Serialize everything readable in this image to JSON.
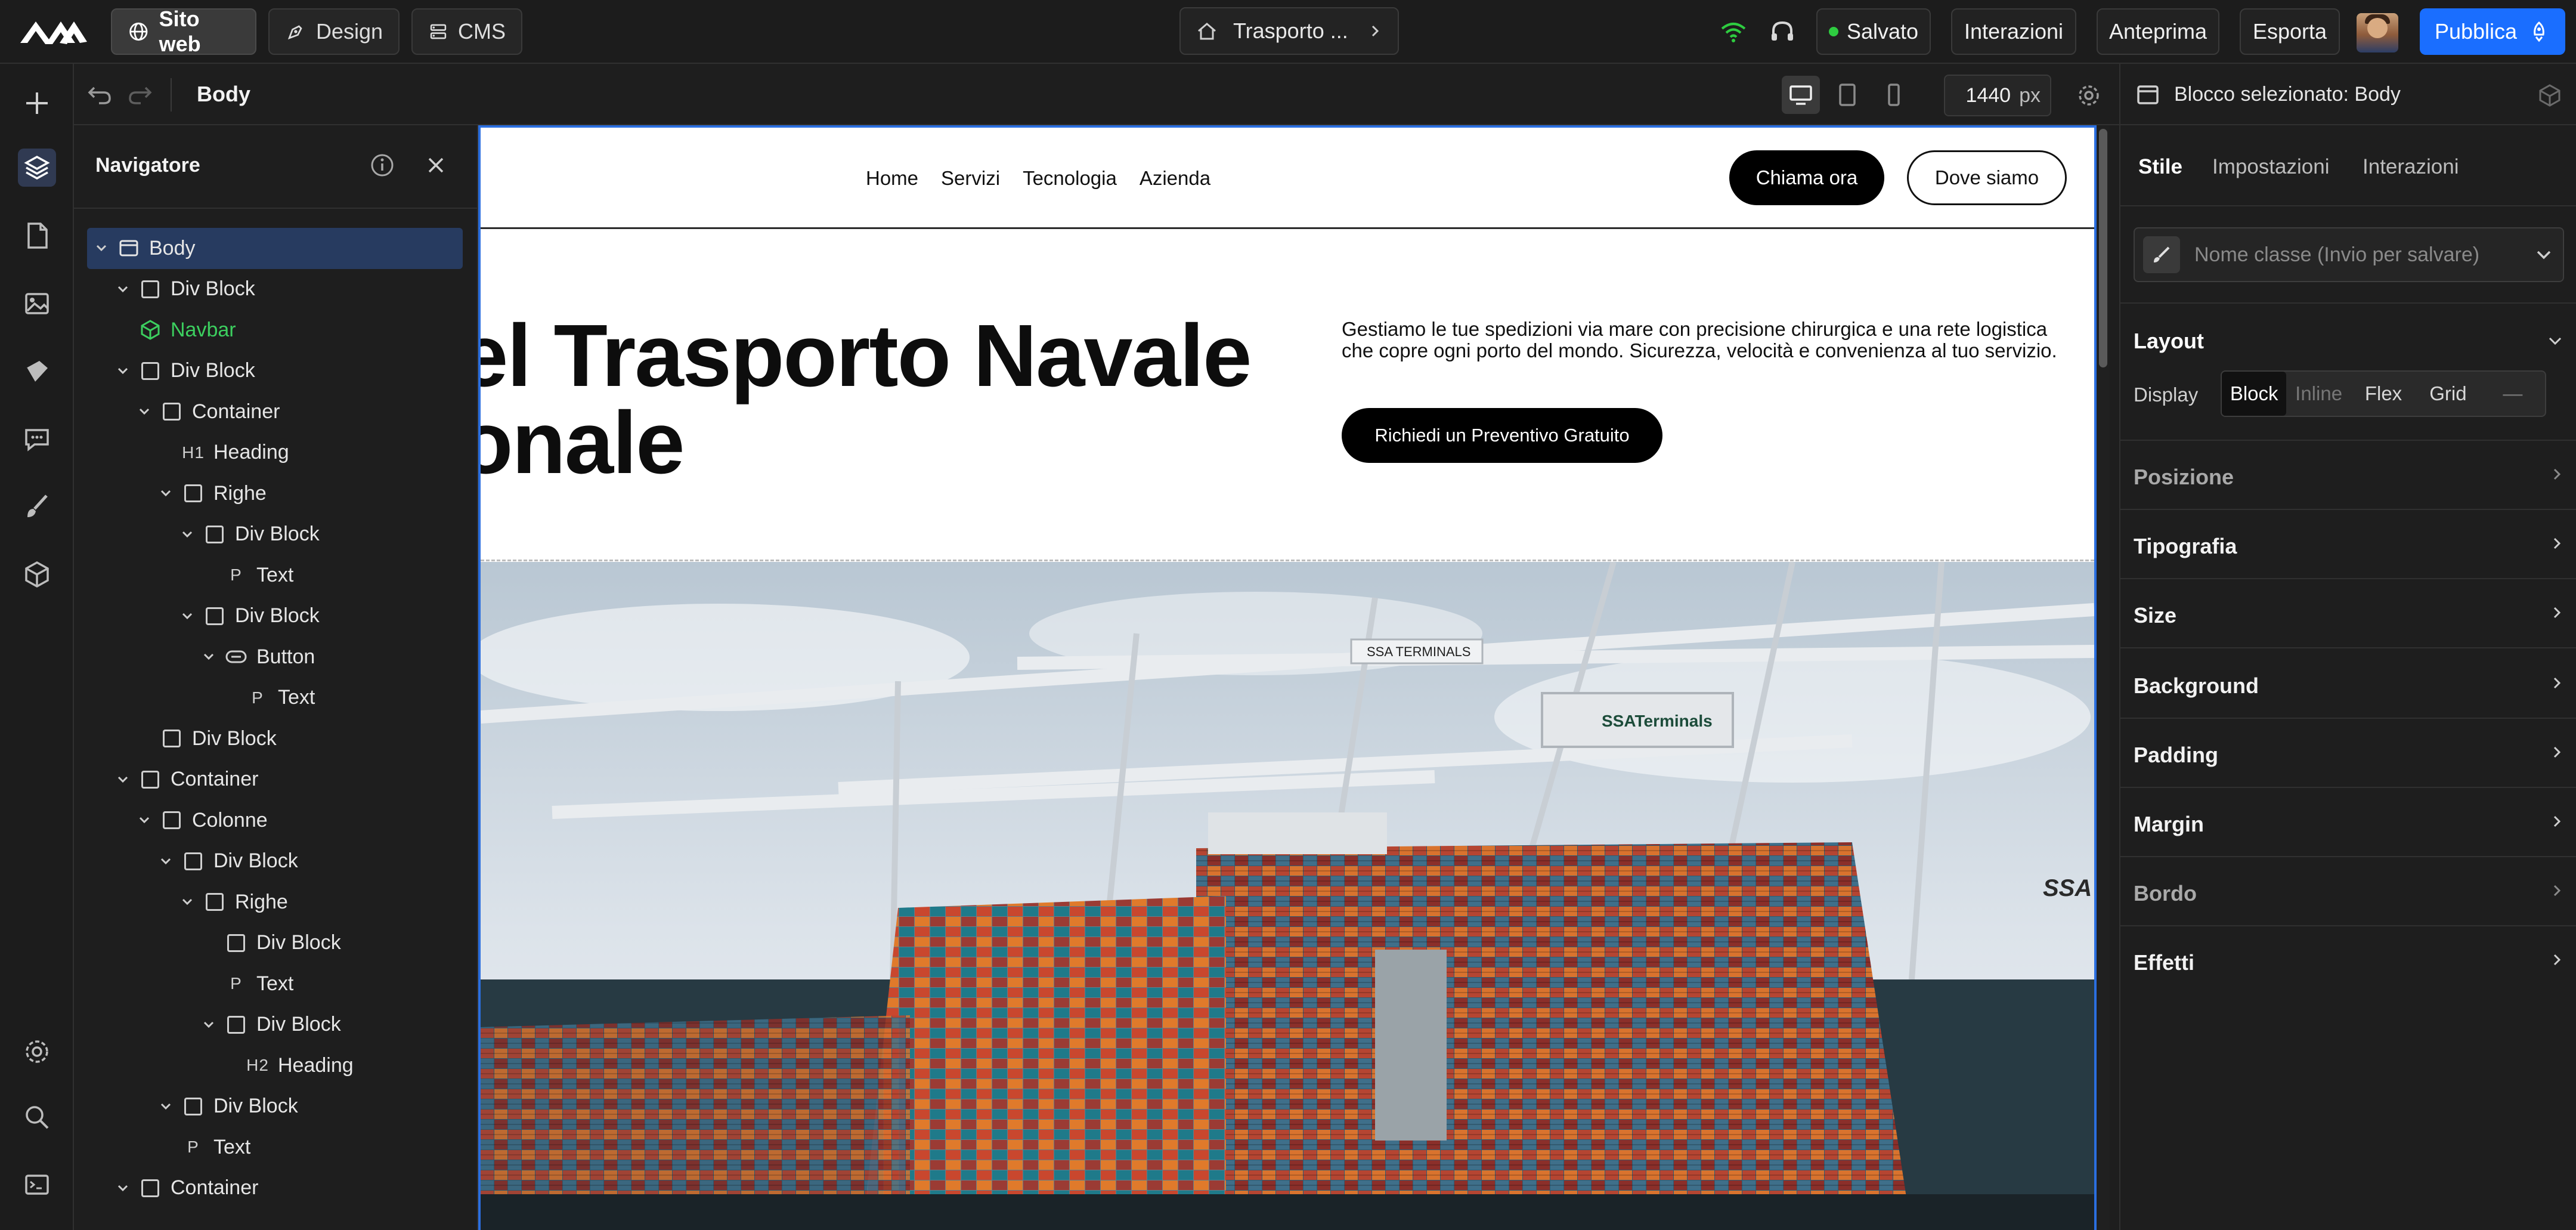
{
  "topbar": {
    "site_label": "Sito web",
    "design_label": "Design",
    "cms_label": "CMS",
    "page_name": "Trasporto ...",
    "saved_label": "Salvato",
    "interactions_label": "Interazioni",
    "preview_label": "Anteprima",
    "export_label": "Esporta",
    "publish_label": "Pubblica"
  },
  "canvas_toolbar": {
    "selected": "Body",
    "width_value": "1440",
    "width_unit": "px"
  },
  "navigator": {
    "title": "Navigatore",
    "items": [
      {
        "label": "Body",
        "type": "body"
      },
      {
        "label": "Div Block",
        "type": "box"
      },
      {
        "label": "Navbar",
        "type": "component"
      },
      {
        "label": "Div Block",
        "type": "box"
      },
      {
        "label": "Container",
        "type": "box"
      },
      {
        "label": "Heading",
        "type": "H1"
      },
      {
        "label": "Righe",
        "type": "box"
      },
      {
        "label": "Div Block",
        "type": "box"
      },
      {
        "label": "Text",
        "type": "P"
      },
      {
        "label": "Div Block",
        "type": "box"
      },
      {
        "label": "Button",
        "type": "button"
      },
      {
        "label": "Text",
        "type": "P"
      },
      {
        "label": "Div Block",
        "type": "box"
      },
      {
        "label": "Container",
        "type": "box"
      },
      {
        "label": "Colonne",
        "type": "box"
      },
      {
        "label": "Div Block",
        "type": "box"
      },
      {
        "label": "Righe",
        "type": "box"
      },
      {
        "label": "Div Block",
        "type": "box"
      },
      {
        "label": "Text",
        "type": "P"
      },
      {
        "label": "Div Block",
        "type": "box"
      },
      {
        "label": "Heading",
        "type": "H2"
      },
      {
        "label": "Div Block",
        "type": "box"
      },
      {
        "label": "Text",
        "type": "P"
      },
      {
        "label": "Container",
        "type": "box"
      }
    ]
  },
  "site": {
    "nav_links": [
      "Home",
      "Servizi",
      "Tecnologia",
      "Azienda"
    ],
    "call_button": "Chiama ora",
    "where_button": "Dove siamo",
    "hero_line1": "el Trasporto Navale",
    "hero_line2": "onale",
    "hero_text": "Gestiamo le tue spedizioni via mare con precisione chirurgica e una rete logistica che copre ogni porto del mondo. Sicurezza, velocità e convenienza al tuo servizio.",
    "hero_cta": "Richiedi un Preventivo Gratuito",
    "crane_sign": "SSA TERMINALS",
    "crane_sign2": "SSATerminals"
  },
  "panel": {
    "selected_block": "Blocco selezionato: Body",
    "tabs": [
      "Stile",
      "Impostazioni",
      "Interazioni"
    ],
    "class_placeholder": "Nome classe (Invio per salvare)",
    "layout_title": "Layout",
    "display_label": "Display",
    "display_options": [
      "Block",
      "Inline",
      "Flex",
      "Grid",
      "—"
    ],
    "sections": [
      "Posizione",
      "Tipografia",
      "Size",
      "Background",
      "Padding",
      "Margin",
      "Bordo",
      "Effetti"
    ]
  },
  "colors": {
    "accent": "#1a6eff",
    "saved_dot": "#2ecc40",
    "selection": "#273b60",
    "component": "#3ccf5f"
  }
}
